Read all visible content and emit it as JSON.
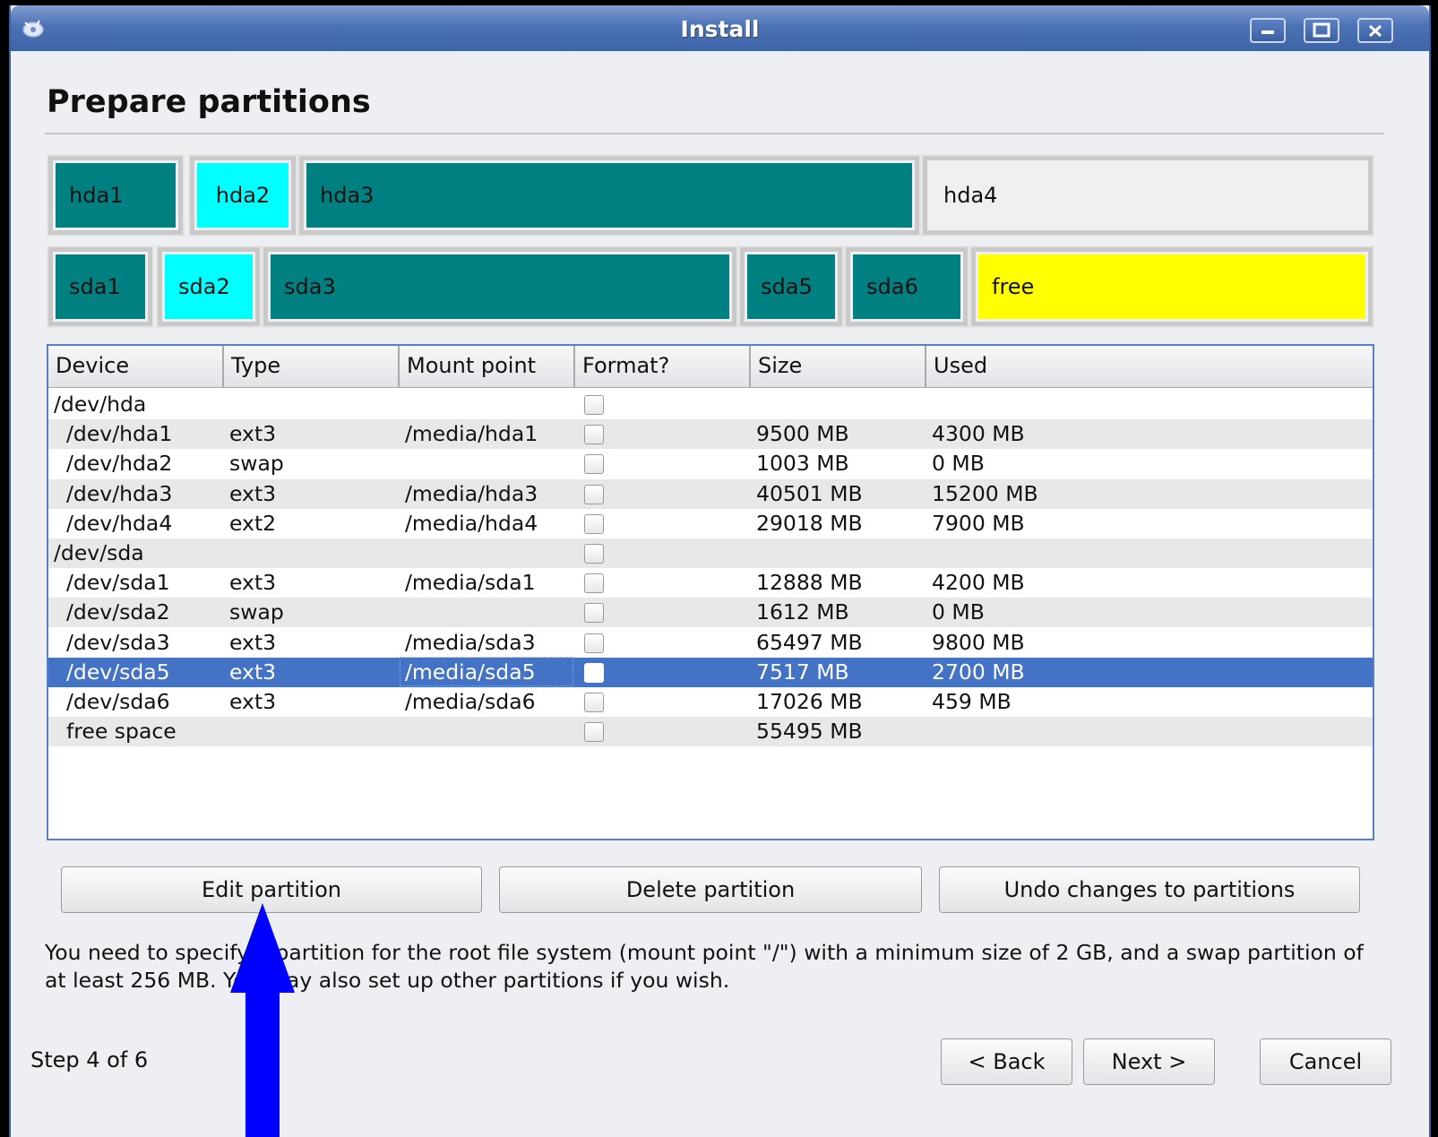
{
  "window": {
    "title": "Install"
  },
  "page": {
    "heading": "Prepare partitions"
  },
  "disk_bars": [
    {
      "device": "hda",
      "segments": [
        {
          "label": "hda1",
          "color": "#008080"
        },
        {
          "label": "hda2",
          "color": "#00ffff"
        },
        {
          "label": "hda3",
          "color": "#008080"
        },
        {
          "label": "hda4",
          "color": "#f0f0f0"
        }
      ]
    },
    {
      "device": "sda",
      "segments": [
        {
          "label": "sda1",
          "color": "#008080"
        },
        {
          "label": "sda2",
          "color": "#00ffff"
        },
        {
          "label": "sda3",
          "color": "#008080"
        },
        {
          "label": "sda5",
          "color": "#008080"
        },
        {
          "label": "sda6",
          "color": "#008080"
        },
        {
          "label": "free",
          "color": "#ffff00"
        }
      ]
    }
  ],
  "table": {
    "columns": [
      "Device",
      "Type",
      "Mount point",
      "Format?",
      "Size",
      "Used"
    ],
    "rows": [
      {
        "device": "/dev/hda",
        "type": "",
        "mount": "",
        "size": "",
        "used": "",
        "indent": false
      },
      {
        "device": "/dev/hda1",
        "type": "ext3",
        "mount": "/media/hda1",
        "size": "9500 MB",
        "used": "4300 MB",
        "indent": true
      },
      {
        "device": "/dev/hda2",
        "type": "swap",
        "mount": "",
        "size": "1003 MB",
        "used": "0 MB",
        "indent": true
      },
      {
        "device": "/dev/hda3",
        "type": "ext3",
        "mount": "/media/hda3",
        "size": "40501 MB",
        "used": "15200 MB",
        "indent": true
      },
      {
        "device": "/dev/hda4",
        "type": "ext2",
        "mount": "/media/hda4",
        "size": "29018 MB",
        "used": "7900 MB",
        "indent": true
      },
      {
        "device": "/dev/sda",
        "type": "",
        "mount": "",
        "size": "",
        "used": "",
        "indent": false
      },
      {
        "device": "/dev/sda1",
        "type": "ext3",
        "mount": "/media/sda1",
        "size": "12888 MB",
        "used": "4200 MB",
        "indent": true
      },
      {
        "device": "/dev/sda2",
        "type": "swap",
        "mount": "",
        "size": "1612 MB",
        "used": "0 MB",
        "indent": true
      },
      {
        "device": "/dev/sda3",
        "type": "ext3",
        "mount": "/media/sda3",
        "size": "65497 MB",
        "used": "9800 MB",
        "indent": true
      },
      {
        "device": "/dev/sda5",
        "type": "ext3",
        "mount": "/media/sda5",
        "size": "7517 MB",
        "used": "2700 MB",
        "indent": true,
        "selected": true
      },
      {
        "device": "/dev/sda6",
        "type": "ext3",
        "mount": "/media/sda6",
        "size": "17026 MB",
        "used": "459 MB",
        "indent": true
      },
      {
        "device": "free space",
        "type": "",
        "mount": "",
        "size": "55495 MB",
        "used": "",
        "indent": true
      }
    ]
  },
  "actions": {
    "edit": "Edit partition",
    "delete": "Delete partition",
    "undo": "Undo changes to partitions"
  },
  "info_text": "You need to specify a partition for the root file system (mount point \"/\") with a minimum size of 2 GB, and a swap partition of at least 256 MB. You may also set up other partitions if you wish.",
  "footer": {
    "step": "Step 4 of 6",
    "back": "< Back",
    "next": "Next >",
    "cancel": "Cancel"
  },
  "colors": {
    "selection": "#4473c5",
    "arrow": "#0000ff",
    "titlebar": "#4c72b6"
  }
}
